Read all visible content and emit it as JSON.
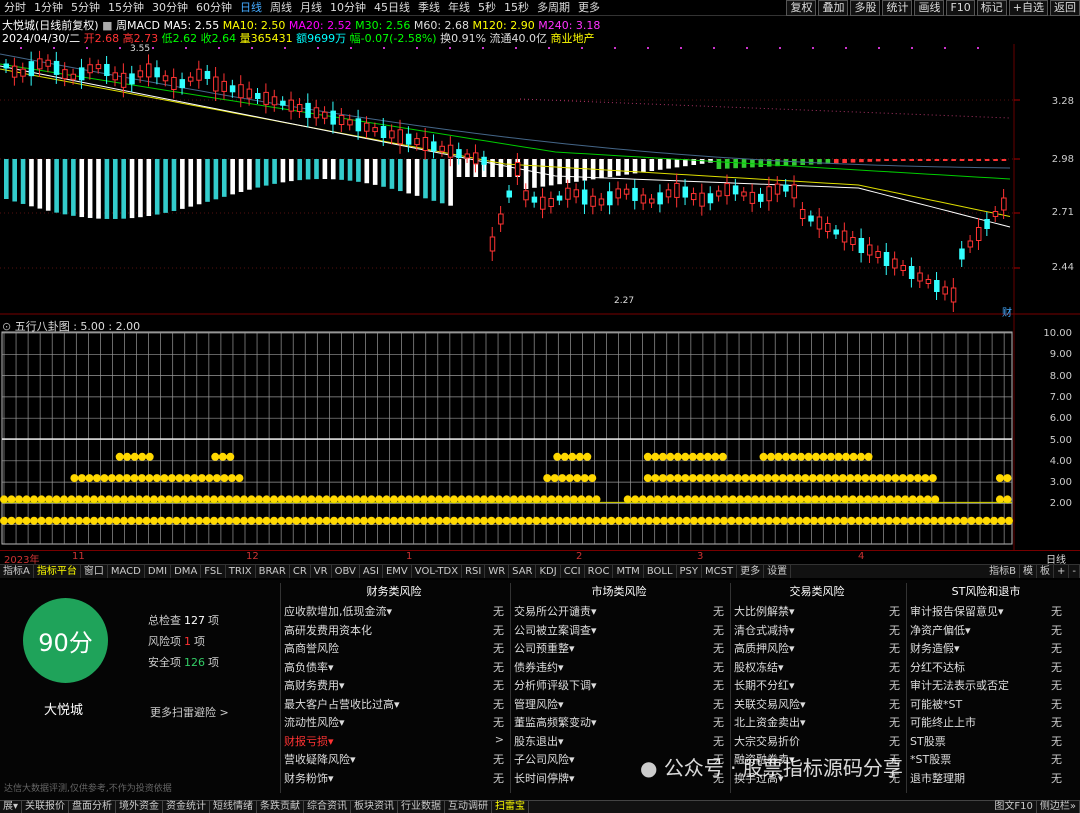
{
  "top_periods": [
    "分时",
    "1分钟",
    "5分钟",
    "15分钟",
    "30分钟",
    "60分钟",
    "日线",
    "周线",
    "月线",
    "10分钟",
    "45日线",
    "季线",
    "年线",
    "5秒",
    "15秒",
    "多周期",
    "更多"
  ],
  "active_period": "日线",
  "right_buttons": [
    "复权",
    "叠加",
    "多股",
    "统计",
    "画线",
    "F10",
    "标记",
    "+自选",
    "返回"
  ],
  "info": {
    "name": "大悦城(日线前复权)",
    "indicator": "周MACD",
    "ma5": "MA5: 2.55",
    "ma10": "MA10: 2.50",
    "ma20": "MA20: 2.52",
    "ma30": "M30: 2.56",
    "m60": "M60: 2.68",
    "m120": "M120: 2.90",
    "m240": "M240: 3.18",
    "date": "2024/04/30/二",
    "open": "开2.68",
    "high": "高2.73",
    "low": "低2.62",
    "close": "收2.64",
    "vol": "量365431",
    "amount": "额9699万",
    "change": "幅-0.07(-2.58%)",
    "turnover": "换0.91%",
    "float": "流通40.0亿",
    "sector": "商业地产"
  },
  "price_ticks": [
    "3.28",
    "2.98",
    "2.71",
    "2.44"
  ],
  "price_labels": {
    "high": "3.55",
    "low": "2.27",
    "cai": "财"
  },
  "indicator_title": "五行八卦图 : 5.00 : 2.00",
  "indicator_ticks": [
    "10.00",
    "9.00",
    "8.00",
    "7.00",
    "6.00",
    "5.00",
    "4.00",
    "3.00",
    "2.00"
  ],
  "indicator_series": {
    "level1": {
      "value": 1.0,
      "from": 0,
      "to": 1
    },
    "level2": {
      "value": 2.0,
      "segments": [
        [
          0,
          0.59
        ],
        [
          0.62,
          0.93
        ],
        [
          0.99,
          1
        ]
      ]
    },
    "level3": {
      "value": 3.0,
      "segments": [
        [
          0.07,
          0.24
        ],
        [
          0.54,
          0.59
        ],
        [
          0.64,
          0.93
        ],
        [
          0.99,
          1
        ]
      ]
    },
    "level4": {
      "value": 4.0,
      "segments": [
        [
          0.115,
          0.145
        ],
        [
          0.21,
          0.23
        ],
        [
          0.55,
          0.58
        ],
        [
          0.64,
          0.72
        ],
        [
          0.755,
          0.865
        ]
      ]
    }
  },
  "time_labels": [
    "2023年",
    "11",
    "12",
    "1",
    "2",
    "3",
    "4",
    "日线"
  ],
  "tabs": [
    "指标A",
    "指标平台",
    "窗口",
    "MACD",
    "DMI",
    "DMA",
    "FSL",
    "TRIX",
    "BRAR",
    "CR",
    "VR",
    "OBV",
    "ASI",
    "EMV",
    "VOL-TDX",
    "RSI",
    "WR",
    "SAR",
    "KDJ",
    "CCI",
    "ROC",
    "MTM",
    "BOLL",
    "PSY",
    "MCST",
    "更多",
    "设置"
  ],
  "tabs_right": [
    "指标B",
    "模",
    "板",
    "+",
    "-"
  ],
  "score": {
    "value": "90分",
    "name": "大悦城",
    "total_label": "总检查",
    "total": "127",
    "risk_label": "风险项",
    "risk": "1",
    "safe_label": "安全项",
    "safe": "126",
    "unit": "项",
    "more": "更多扫雷避险 >",
    "disclaimer": "达信大数据评测,仅供参考,不作为投资依据"
  },
  "columns": [
    {
      "title": "财务类风险",
      "rows": [
        {
          "label": "应收款增加,低现金流▾",
          "value": "无"
        },
        {
          "label": "高研发费用资本化",
          "value": "无"
        },
        {
          "label": "高商誉风险",
          "value": "无"
        },
        {
          "label": "高负债率▾",
          "value": "无"
        },
        {
          "label": "高财务费用▾",
          "value": "无"
        },
        {
          "label": "最大客户占营收比过高▾",
          "value": "无"
        },
        {
          "label": "流动性风险▾",
          "value": "无"
        },
        {
          "label": "财报亏损▾",
          "value": ">",
          "red": true
        },
        {
          "label": "营收疑降风险▾",
          "value": "无"
        },
        {
          "label": "财务粉饰▾",
          "value": "无"
        }
      ]
    },
    {
      "title": "市场类风险",
      "rows": [
        {
          "label": "交易所公开谴责▾",
          "value": "无"
        },
        {
          "label": "公司被立案调查▾",
          "value": "无"
        },
        {
          "label": "公司预重整▾",
          "value": "无"
        },
        {
          "label": "债券违约▾",
          "value": "无"
        },
        {
          "label": "分析师评级下调▾",
          "value": "无"
        },
        {
          "label": "管理风险▾",
          "value": "无"
        },
        {
          "label": "董监高频繁变动▾",
          "value": "无"
        },
        {
          "label": "股东退出▾",
          "value": "无"
        },
        {
          "label": "子公司风险▾",
          "value": "无"
        },
        {
          "label": "长时间停牌▾",
          "value": "无"
        }
      ]
    },
    {
      "title": "交易类风险",
      "rows": [
        {
          "label": "大比例解禁▾",
          "value": "无"
        },
        {
          "label": "清仓式减持▾",
          "value": "无"
        },
        {
          "label": "高质押风险▾",
          "value": "无"
        },
        {
          "label": "股权冻结▾",
          "value": "无"
        },
        {
          "label": "长期不分红▾",
          "value": "无"
        },
        {
          "label": "关联交易风险▾",
          "value": "无"
        },
        {
          "label": "北上资金卖出▾",
          "value": "无"
        },
        {
          "label": "大宗交易折价",
          "value": "无"
        },
        {
          "label": "融资融券卖▾",
          "value": "无"
        },
        {
          "label": "换手过高▾",
          "value": "无"
        }
      ]
    },
    {
      "title": "ST风险和退市",
      "rows": [
        {
          "label": "审计报告保留意见▾",
          "value": "无"
        },
        {
          "label": "净资产偏低▾",
          "value": "无"
        },
        {
          "label": "财务造假▾",
          "value": "无"
        },
        {
          "label": "分红不达标",
          "value": "无"
        },
        {
          "label": "审计无法表示或否定",
          "value": "无"
        },
        {
          "label": "可能被*ST",
          "value": "无"
        },
        {
          "label": "可能终止上市",
          "value": "无"
        },
        {
          "label": "ST股票",
          "value": "无"
        },
        {
          "label": "*ST股票",
          "value": "无"
        },
        {
          "label": "退市整理期",
          "value": "无"
        }
      ]
    }
  ],
  "watermark": "公众号 · 股票指标源码分享",
  "bottom_tabs": [
    "展▾",
    "关联报价",
    "盘面分析",
    "境外资金",
    "资金统计",
    "短线情绪",
    "条跌贡献",
    "综合资讯",
    "板块资讯",
    "行业数据",
    "互动调研",
    "扫雷宝"
  ],
  "bottom_active": "扫雷宝",
  "bottom_right": [
    "图文F10",
    "侧边栏»"
  ],
  "colors": {
    "up": "#ff3333",
    "down": "#33ffff",
    "ma5": "#ffffff",
    "ma10": "#ffff00",
    "ma20": "#ff00ff",
    "ma60": "#00ff00",
    "accent": "#1fa35a",
    "dot": "#ffd800"
  }
}
